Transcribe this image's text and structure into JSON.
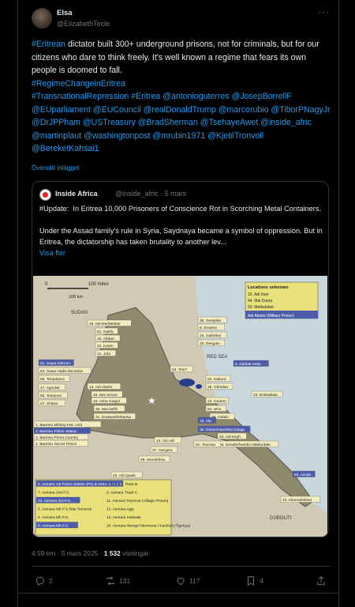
{
  "author": {
    "name": "Elsa",
    "handle": "@ElizabethTecle"
  },
  "more_label": "···",
  "post": {
    "segments": [
      {
        "t": "#Eritrean",
        "link": true
      },
      {
        "t": " dictator built 300+ underground prisons, not for criminals, but for our citizens who dare to think freely. It's well known a regime that fears its own people is doomed to fall.",
        "link": false
      },
      {
        "t": "\n",
        "link": false
      },
      {
        "t": "#RegimeChangeinEritrea",
        "link": true
      },
      {
        "t": "\n",
        "link": false
      },
      {
        "t": "#TransnationalRepression #Eritrea @antonioguterres @JosepBorrellF @EUparliament @EUCouncil @realDonaldTrump @marcorubio @TiborPNagyJr @DrJPPham @USTreasury @BradSherman @TsehayeAwet @inside_afric @martinplaut @washingtonpost @mrubin1971 @KjetilTronvoll @BereketKahsai1",
        "link": true
      }
    ],
    "translate_label": "Översätt inlägget"
  },
  "quote": {
    "name": "Inside Africa",
    "meta": "@inside_afric · 5 mars",
    "text": "#Update:  In Eritrea 10,000 Prisoners of Conscience Rot in Scorching Metal Containers.\n\nUnder the Assad family's rule in Syria, Saydnaya became a symbol of oppression. But in Eritrea, the dictatorship has taken brutality to another lev...",
    "more_label": "Visa fler",
    "map": {
      "scale": [
        "0",
        "100 miles",
        "100 km"
      ],
      "regions": [
        "SUDAN",
        "RED SEA",
        "DJIBOUTI"
      ],
      "unknown_title": "Locations unknown",
      "unknown_list": [
        "15. Adi Imer",
        "44. Mai Duma",
        "50. Metkelabet"
      ],
      "unknown_extra": "Adi Abeito (Military Prison)",
      "labels_right": [
        "39. Serejeka",
        "8. Eiraeiro",
        "16. Gahteley",
        "30. Dengolo",
        "53. Tsio?",
        "6. Dahlak Kebir",
        "52. Nakura",
        "38. Ghindae",
        "33. Embatkala",
        "23. Godem",
        "62. Wi'a",
        "36. Gelalo",
        "18. Ala",
        "35. Dekemhare/Mai Edaga",
        "20. Adi Keyh",
        "55. Senafe/Nambo Ndafurdale",
        "61. Tsorona",
        "63. Assab",
        "43. Kiloma/Kilima"
      ],
      "labels_left": [
        "48. Me'eter/Mettier",
        "51. Nakfa",
        "16. Afabet",
        "42. Karen",
        "41. Jufa",
        "54. Sawa Aderum",
        "54. Sawa Hadis Ma'askar",
        "58. Tehadasso",
        "17. Agordat",
        "60. Tessenei",
        "57. Shilalo",
        "14. Adi Abeito",
        "46. Mai Serwa",
        "19. Asha Golgol",
        "45. Mai Nefhi",
        "31. Duarwa/Debarwa",
        "1. Barentu Military Inst. Unit",
        "2. Barentu Police Station",
        "3. Barentu Prima Country",
        "4. Barentu Secret Prison",
        "14. Abi Adi",
        "37. Gergera",
        "49. Mendefera",
        "22. Adi Quala"
      ],
      "asmara_list": [
        "5. Asmara 1st Police Station (P1) & Asmara Sembel",
        "8. Asmara Track B",
        "7. Asmara 2nd P.S.",
        "9. Asmara Track C",
        "10. Asmara 3rd P.S.",
        "11. Asmara Tserenat (Villagio Prison)",
        "5. Asmara 4th P.S./Mai Temenai",
        "12. Asmara Agip",
        "6. Asmara 5th P.S.",
        "13. Asmara Haliwale",
        "6. Asmara 6th P.S.",
        "26. Asmara Wengel Mermerai / Karsheli (Tigrinya)"
      ]
    }
  },
  "timestamp": {
    "time": "4:59 em · 5 mars 2025 · ",
    "views": "1 532",
    "views_label": " visningar"
  },
  "actions": {
    "replies": "2",
    "reposts": "131",
    "likes": "117",
    "bookmarks": "4"
  }
}
